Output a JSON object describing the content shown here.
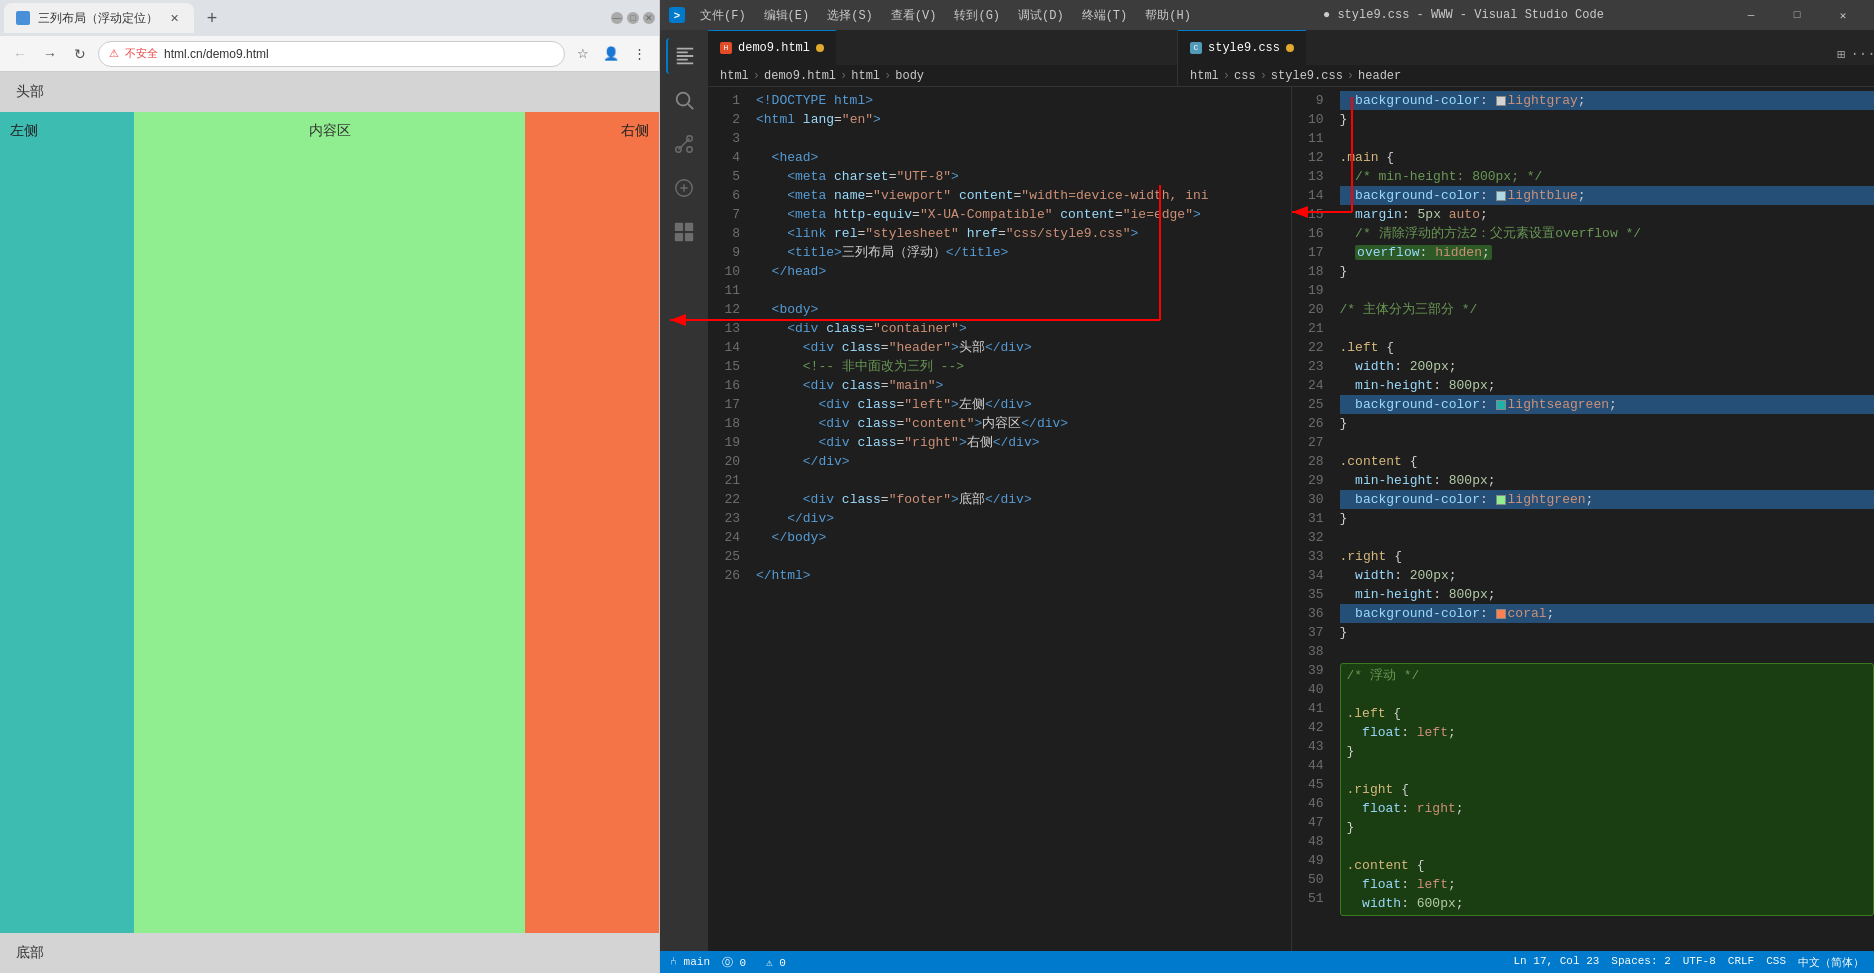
{
  "browser": {
    "tab_title": "三列布局（浮动定位）",
    "url": "html.cn/demo9.html",
    "url_security": "不安全",
    "page": {
      "header": "头部",
      "left": "左侧",
      "content": "内容区",
      "right": "右侧",
      "footer": "底部"
    }
  },
  "vscode": {
    "title": "● style9.css - WWW - Visual Studio Code",
    "menus": [
      "文件(F)",
      "编辑(E)",
      "选择(S)",
      "查看(V)",
      "转到(G)",
      "调试(D)",
      "终端(T)",
      "帮助(H)"
    ],
    "tabs": {
      "left": "demo9.html",
      "right": "style9.css"
    },
    "breadcrumb_html": [
      "html",
      "demo9.html",
      "html",
      "body"
    ],
    "breadcrumb_css": [
      "html",
      "css",
      "style9.css",
      "header"
    ],
    "html_code": [
      {
        "num": 1,
        "text": "<!DOCTYPE html>"
      },
      {
        "num": 2,
        "text": "<html lang=\"en\">"
      },
      {
        "num": 3,
        "text": ""
      },
      {
        "num": 4,
        "text": "  <head>"
      },
      {
        "num": 5,
        "text": "    <meta charset=\"UTF-8\">"
      },
      {
        "num": 6,
        "text": "    <meta name=\"viewport\" content=\"width=device-width, ini"
      },
      {
        "num": 7,
        "text": "    <meta http-equiv=\"X-UA-Compatible\" content=\"ie=edge\">"
      },
      {
        "num": 8,
        "text": "    <link rel=\"stylesheet\" href=\"css/style9.css\">"
      },
      {
        "num": 9,
        "text": "    <title>三列布局（浮动）</title>"
      },
      {
        "num": 10,
        "text": "  </head>"
      },
      {
        "num": 11,
        "text": ""
      },
      {
        "num": 12,
        "text": "  <body>"
      },
      {
        "num": 13,
        "text": "    <div class=\"container\">"
      },
      {
        "num": 14,
        "text": "      <div class=\"header\">头部</div>"
      },
      {
        "num": 15,
        "text": "      <!-- 非中面改为三列 -->"
      },
      {
        "num": 16,
        "text": "      <div class=\"main\">"
      },
      {
        "num": 17,
        "text": "        <div class=\"left\">左侧</div>"
      },
      {
        "num": 18,
        "text": "        <div class=\"content\">内容区</div>"
      },
      {
        "num": 19,
        "text": "        <div class=\"right\">右侧</div>"
      },
      {
        "num": 20,
        "text": "      </div>"
      },
      {
        "num": 21,
        "text": ""
      },
      {
        "num": 22,
        "text": "      <div class=\"footer\">底部</div>"
      },
      {
        "num": 23,
        "text": "    </div>"
      },
      {
        "num": 24,
        "text": "  </body>"
      },
      {
        "num": 25,
        "text": ""
      },
      {
        "num": 26,
        "text": "</html>"
      }
    ],
    "css_code": [
      {
        "num": 9,
        "text": "  background-color: ◻ lightgray;",
        "highlight": true
      },
      {
        "num": 10,
        "text": "}"
      },
      {
        "num": 11,
        "text": ""
      },
      {
        "num": 12,
        "text": ".main {"
      },
      {
        "num": 13,
        "text": "  /* min-height: 800px; */"
      },
      {
        "num": 14,
        "text": "  background-color: ◻ lightblue;",
        "highlight": true
      },
      {
        "num": 15,
        "text": "  margin: 5px auto;"
      },
      {
        "num": 16,
        "text": "  /* 清除浮动的方法2：父元素设置overflow */"
      },
      {
        "num": 17,
        "text": "  overflow: hidden;",
        "green_hl": true
      },
      {
        "num": 18,
        "text": "}"
      },
      {
        "num": 19,
        "text": ""
      },
      {
        "num": 20,
        "text": "/* 主体分为三部分 */"
      },
      {
        "num": 21,
        "text": ""
      },
      {
        "num": 22,
        "text": ".left {"
      },
      {
        "num": 23,
        "text": "  width: 200px;"
      },
      {
        "num": 24,
        "text": "  min-height: 800px;"
      },
      {
        "num": 25,
        "text": "  background-color: ◻ lightseagreen;",
        "highlight": true
      },
      {
        "num": 26,
        "text": "}"
      },
      {
        "num": 27,
        "text": ""
      },
      {
        "num": 28,
        "text": ".content {"
      },
      {
        "num": 29,
        "text": "  min-height: 800px;"
      },
      {
        "num": 30,
        "text": "  background-color: ◻ lightgreen;",
        "highlight": true
      },
      {
        "num": 31,
        "text": "}"
      },
      {
        "num": 32,
        "text": ""
      },
      {
        "num": 33,
        "text": ".right {"
      },
      {
        "num": 34,
        "text": "  width: 200px;"
      },
      {
        "num": 35,
        "text": "  min-height: 800px;"
      },
      {
        "num": 36,
        "text": "  background-color: ◻ coral;",
        "highlight": true
      },
      {
        "num": 37,
        "text": "}"
      },
      {
        "num": 38,
        "text": ""
      },
      {
        "num": 39,
        "text": "/* 浮动 */"
      },
      {
        "num": 40,
        "text": ""
      },
      {
        "num": 41,
        "text": ".left {"
      },
      {
        "num": 42,
        "text": "  float: left;"
      },
      {
        "num": 43,
        "text": "}"
      },
      {
        "num": 44,
        "text": ""
      },
      {
        "num": 45,
        "text": ".right {"
      },
      {
        "num": 46,
        "text": "  float: right;"
      },
      {
        "num": 47,
        "text": "}"
      },
      {
        "num": 48,
        "text": ""
      },
      {
        "num": 49,
        "text": ".content {"
      },
      {
        "num": 50,
        "text": "  float: left;"
      },
      {
        "num": 51,
        "text": "  width: 600px;"
      }
    ],
    "statusbar": {
      "branch": "main",
      "errors": "⓪ 0  ⚠ 0",
      "right_items": [
        "Ln 17, Col 23",
        "Spaces: 2",
        "UTF-8",
        "CRLF",
        "CSS",
        "中文（简体）"
      ]
    }
  }
}
